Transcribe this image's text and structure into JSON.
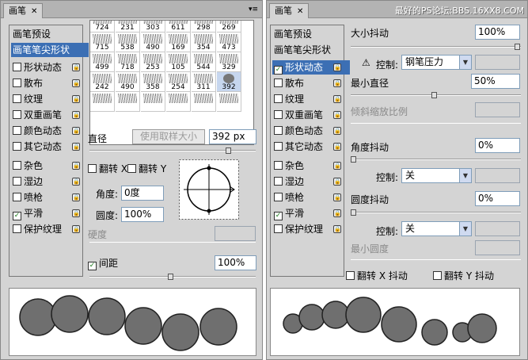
{
  "left": {
    "tab_title": "画笔",
    "tab_close": "✕",
    "menu_glyph": "▾≡",
    "list_items": [
      {
        "label": "画笔预设",
        "type": "header"
      },
      {
        "label": "画笔笔尖形状",
        "type": "selected"
      },
      {
        "label": "形状动态",
        "checked": false,
        "lock": true
      },
      {
        "label": "散布",
        "checked": false,
        "lock": true
      },
      {
        "label": "纹理",
        "checked": false,
        "lock": true
      },
      {
        "label": "双重画笔",
        "checked": false,
        "lock": true
      },
      {
        "label": "颜色动态",
        "checked": false,
        "lock": true
      },
      {
        "label": "其它动态",
        "checked": false,
        "lock": true
      },
      {
        "label": "杂色",
        "checked": false,
        "lock": true
      },
      {
        "label": "湿边",
        "checked": false,
        "lock": true
      },
      {
        "label": "喷枪",
        "checked": false,
        "lock": true
      },
      {
        "label": "平滑",
        "checked": true,
        "lock": true
      },
      {
        "label": "保护纹理",
        "checked": false,
        "lock": true
      }
    ],
    "brush_sizes": [
      "724",
      "231",
      "303",
      "611",
      "298",
      "269",
      "715",
      "538",
      "490",
      "169",
      "354",
      "473",
      "499",
      "718",
      "253",
      "105",
      "544",
      "329",
      "242",
      "490",
      "358",
      "254",
      "311",
      "392",
      "",
      "",
      "",
      "",
      "",
      ""
    ],
    "diameter_label": "直径",
    "sample_size_button": "使用取样大小",
    "diameter_value": "392 px",
    "flip_x": "翻转 X",
    "flip_y": "翻转 Y",
    "angle_label": "角度:",
    "angle_value": "0度",
    "roundness_label": "圆度:",
    "roundness_value": "100%",
    "hardness_label": "硬度",
    "spacing_label": "间距",
    "spacing_checked": true,
    "spacing_value": "100%"
  },
  "right": {
    "tab_title": "画笔",
    "tab_close": "✕",
    "watermark": "最好的PS论坛:BBS.16XX8.COM",
    "list_items": [
      {
        "label": "画笔预设",
        "type": "header"
      },
      {
        "label": "画笔笔尖形状",
        "type": "plain"
      },
      {
        "label": "形状动态",
        "checked": true,
        "lock": true,
        "type": "selected"
      },
      {
        "label": "散布",
        "checked": false,
        "lock": true
      },
      {
        "label": "纹理",
        "checked": false,
        "lock": true
      },
      {
        "label": "双重画笔",
        "checked": false,
        "lock": true
      },
      {
        "label": "颜色动态",
        "checked": false,
        "lock": true
      },
      {
        "label": "其它动态",
        "checked": false,
        "lock": true
      },
      {
        "label": "杂色",
        "checked": false,
        "lock": true
      },
      {
        "label": "湿边",
        "checked": false,
        "lock": true
      },
      {
        "label": "喷枪",
        "checked": false,
        "lock": true
      },
      {
        "label": "平滑",
        "checked": true,
        "lock": true
      },
      {
        "label": "保护纹理",
        "checked": false,
        "lock": true
      }
    ],
    "size_jitter_label": "大小抖动",
    "size_jitter_value": "100%",
    "control_label": "控制:",
    "control1_value": "钢笔压力",
    "min_diameter_label": "最小直径",
    "min_diameter_value": "50%",
    "tilt_scale_label": "倾斜缩放比例",
    "angle_jitter_label": "角度抖动",
    "angle_jitter_value": "0%",
    "control2_value": "关",
    "roundness_jitter_label": "圆度抖动",
    "roundness_jitter_value": "0%",
    "control3_value": "关",
    "min_roundness_label": "最小圆度",
    "flip_x_jitter": "翻转 X 抖动",
    "flip_y_jitter": "翻转 Y 抖动"
  }
}
